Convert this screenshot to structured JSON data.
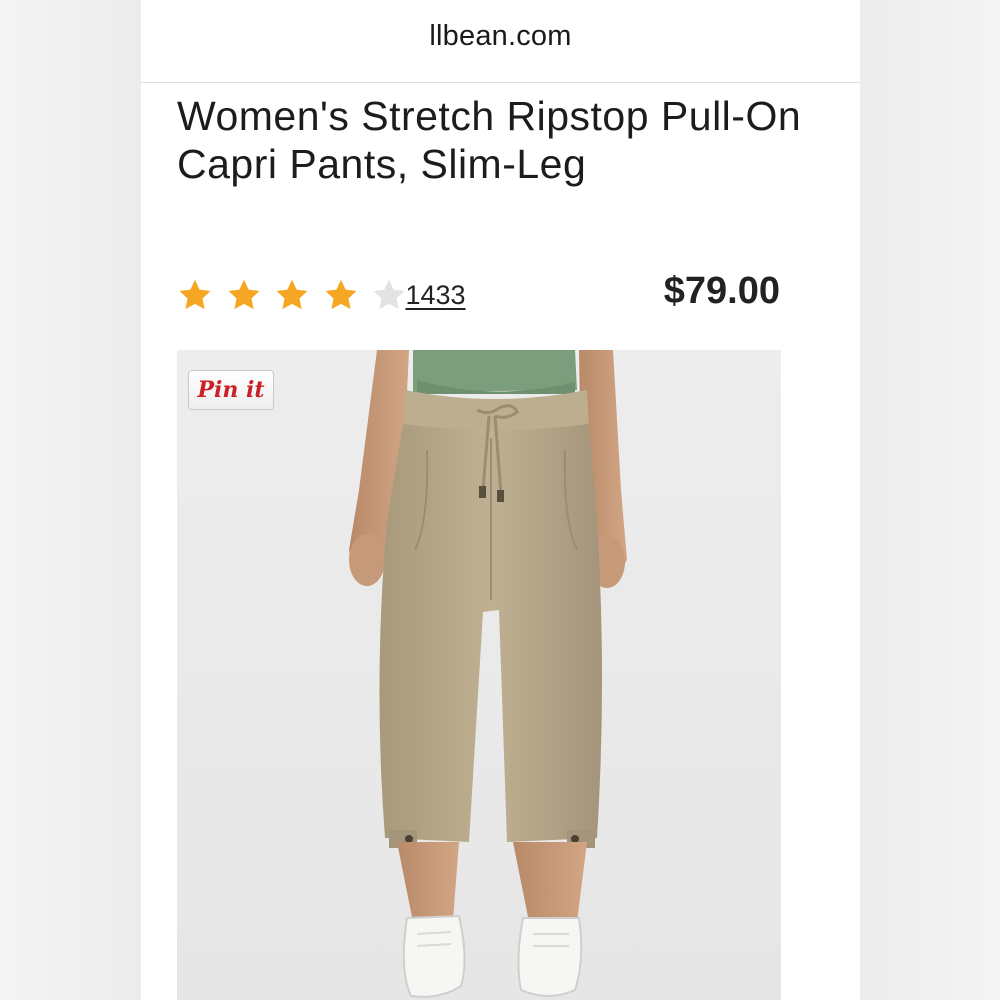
{
  "browser": {
    "url": "llbean.com"
  },
  "product": {
    "title": "Women's Stretch Ripstop Pull-On Capri Pants, Slim-Leg",
    "rating": 4,
    "rating_max": 5,
    "review_count": "1433",
    "price": "$79.00"
  },
  "image": {
    "pin_button_label": "Pin it",
    "alt": "Model wearing khaki capri pants"
  },
  "colors": {
    "star_filled": "#f5a623",
    "star_empty": "#d8d8d8",
    "pin_red": "#cb2027",
    "pants_khaki": "#b8a88a",
    "top_sage": "#7d9e7d"
  }
}
